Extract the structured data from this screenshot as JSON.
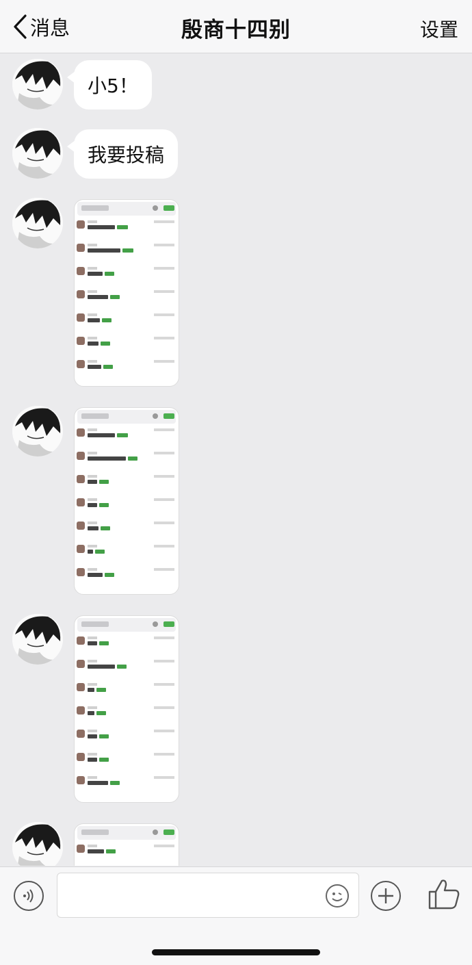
{
  "header": {
    "back_label": "消息",
    "title": "殷商十四别",
    "settings_label": "设置"
  },
  "messages": [
    {
      "type": "text",
      "text": "小5！"
    },
    {
      "type": "text",
      "text": "我要投稿"
    },
    {
      "type": "image",
      "description_icon": "screenshot-thumbnail"
    },
    {
      "type": "image",
      "description_icon": "screenshot-thumbnail"
    },
    {
      "type": "image",
      "description_icon": "screenshot-thumbnail"
    },
    {
      "type": "image",
      "description_icon": "screenshot-thumbnail"
    }
  ],
  "input": {
    "placeholder": ""
  },
  "colors": {
    "background": "#ebebed",
    "header": "#f7f7f8",
    "bubble": "#ffffff",
    "highlight": "#43a047"
  }
}
